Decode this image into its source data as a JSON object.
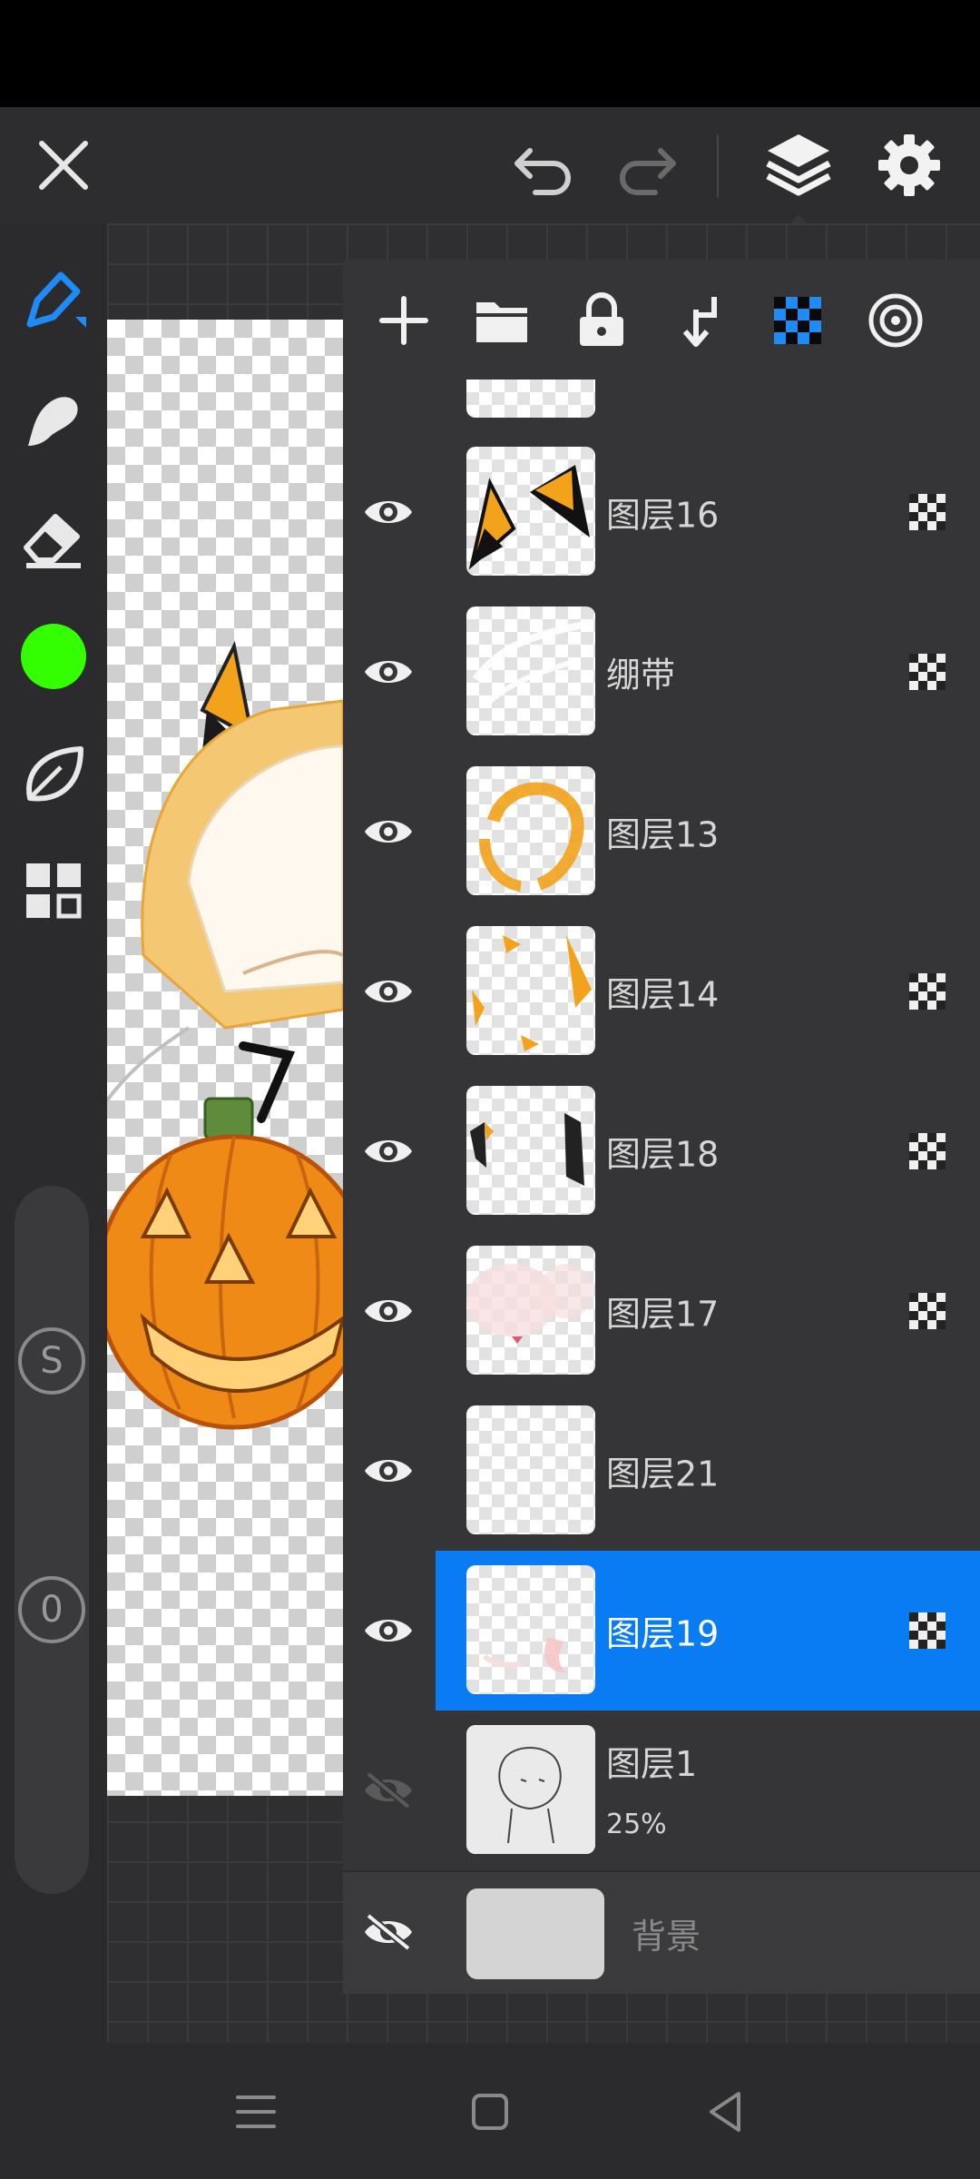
{
  "toolbar": {
    "icons": [
      "close-icon",
      "undo-icon",
      "redo-icon",
      "layers-icon",
      "settings-icon"
    ]
  },
  "tools": [
    "brush-icon",
    "smudge-icon",
    "eraser-icon",
    "color-swatch",
    "leaf-icon",
    "grid-icon"
  ],
  "colors": {
    "current_color": "#33ff00",
    "accent": "#0a7cf3",
    "panel": "#353537"
  },
  "slider": {
    "size_label": "S",
    "opacity_label": "0"
  },
  "layers_toolbar": {
    "icons": [
      "add-layer-icon",
      "folder-icon",
      "lock-icon",
      "merge-down-icon",
      "alpha-lock-icon",
      "blend-icon"
    ]
  },
  "layers": [
    {
      "name": "图层16",
      "visible": true,
      "alpha_lock": true,
      "selected": false
    },
    {
      "name": "绷带",
      "visible": true,
      "alpha_lock": true,
      "selected": false
    },
    {
      "name": "图层13",
      "visible": true,
      "alpha_lock": false,
      "selected": false
    },
    {
      "name": "图层14",
      "visible": true,
      "alpha_lock": true,
      "selected": false
    },
    {
      "name": "图层18",
      "visible": true,
      "alpha_lock": true,
      "selected": false
    },
    {
      "name": "图层17",
      "visible": true,
      "alpha_lock": true,
      "selected": false
    },
    {
      "name": "图层21",
      "visible": true,
      "alpha_lock": false,
      "selected": false
    },
    {
      "name": "图层19",
      "visible": true,
      "alpha_lock": true,
      "selected": true
    },
    {
      "name": "图层1",
      "opacity": "25%",
      "visible": false,
      "alpha_lock": false,
      "selected": false
    }
  ],
  "background_layer": {
    "name": "背景",
    "visible": false
  },
  "nav": {
    "icons": [
      "menu-icon",
      "home-icon",
      "back-icon"
    ]
  }
}
